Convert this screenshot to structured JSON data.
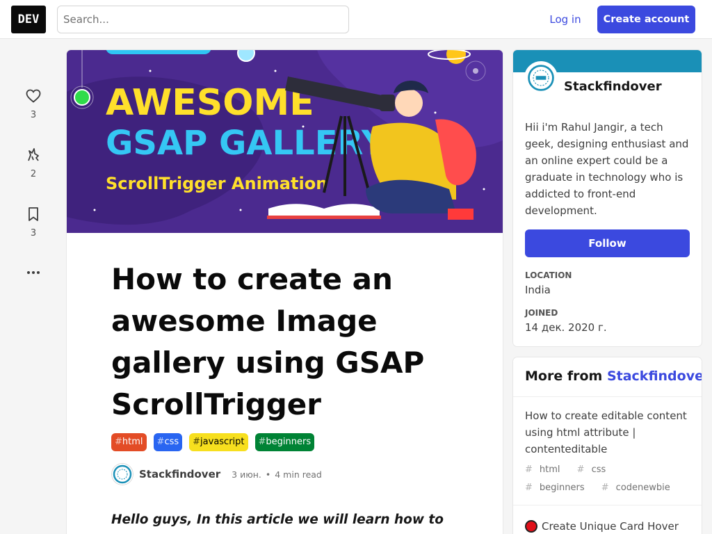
{
  "header": {
    "logo": "DEV",
    "search_placeholder": "Search...",
    "login_label": "Log in",
    "create_account_label": "Create account"
  },
  "reactions": {
    "likes": "3",
    "unicorns": "2",
    "bookmarks": "3"
  },
  "cover": {
    "line1": "AWESOME",
    "line2": "GSAP GALLERY",
    "line3": "ScrollTrigger Animation",
    "bg_color": "#4b2a8f"
  },
  "article": {
    "title": "How to create an awesome Image gallery using GSAP ScrollTrigger",
    "tags": [
      {
        "name": "html",
        "color": "#e34c26"
      },
      {
        "name": "css",
        "color": "#2965f1"
      },
      {
        "name": "javascript",
        "color": "#f7df1e"
      },
      {
        "name": "beginners",
        "color": "#008335"
      }
    ],
    "author": "Stackfindover",
    "date": "3 июн.",
    "read_time": "4 min read",
    "intro": "Hello guys, In this article we will learn how to create"
  },
  "author_card": {
    "name": "Stackfindover",
    "bio": "Hii i'm Rahul Jangir, a tech geek, designing enthusiast and an online expert could be a graduate in technology who is addicted to front-end development.",
    "follow_label": "Follow",
    "location_label": "LOCATION",
    "location": "India",
    "joined_label": "JOINED",
    "joined": "14 дек. 2020 г.",
    "brand_color": "#1a90b7"
  },
  "more_from": {
    "prefix": "More from",
    "author": "Stackfindover",
    "items": [
      {
        "title": "How to create editable content using html attribute | contenteditable",
        "tags": [
          "html",
          "css",
          "beginners",
          "codenewbie"
        ]
      },
      {
        "title": "Create Unique Card Hover"
      }
    ]
  }
}
